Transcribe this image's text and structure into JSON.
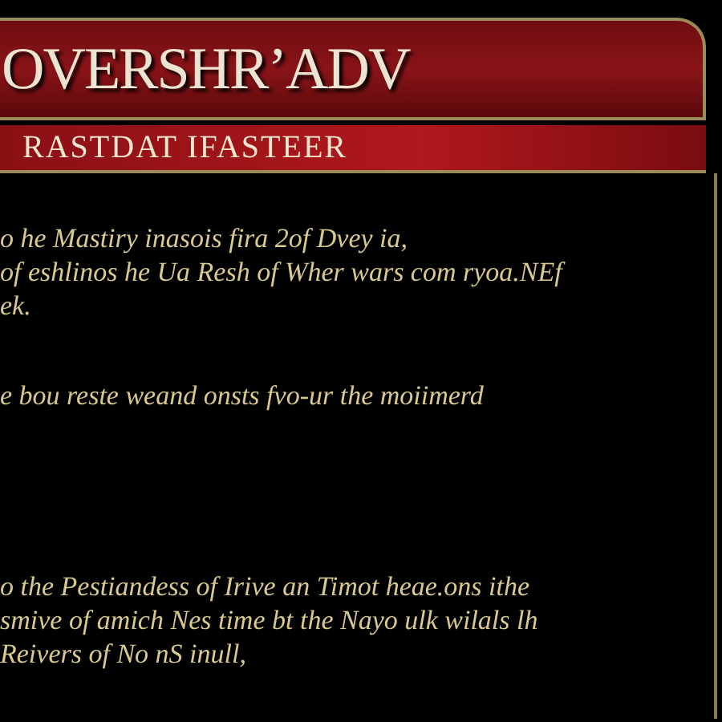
{
  "panel": {
    "title": "OVERSHR’ADV",
    "subtitle": "RASTDAT IFASTEER",
    "paragraphs": [
      {
        "lines": [
          "o he Mastiry inasois fira 2of Dvey ia,",
          "of eshlinos he Ua Resh of Wher wars com ryoa.NEf",
          "ek."
        ]
      },
      {
        "lines": [
          "e bou reste weand onsts fvo-ur the moiimerd"
        ]
      },
      {
        "lines": [
          "o the Pestiandess of Irive an Timot heae.ons ithe",
          "smive of amich Nes time bt the Nayo ulk wilals lh",
          "Reivers of No nS inull,"
        ]
      }
    ]
  }
}
